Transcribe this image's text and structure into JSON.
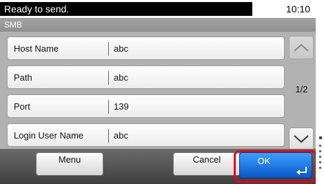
{
  "status": {
    "message": "Ready to send.",
    "time": "10:10"
  },
  "screen_title": "SMB",
  "rows": [
    {
      "label": "Host Name",
      "value": "abc"
    },
    {
      "label": "Path",
      "value": "abc"
    },
    {
      "label": "Port",
      "value": "139"
    },
    {
      "label": "Login User Name",
      "value": "abc"
    }
  ],
  "pager": {
    "indicator": "1/2",
    "up_icon": "chevron-up-icon",
    "down_icon": "chevron-down-icon"
  },
  "buttons": {
    "menu": "Menu",
    "cancel": "Cancel",
    "ok": "OK",
    "ok_icon": "enter-icon"
  },
  "colors": {
    "highlight": "#e60012",
    "ok_blue": "#0a55c8"
  }
}
